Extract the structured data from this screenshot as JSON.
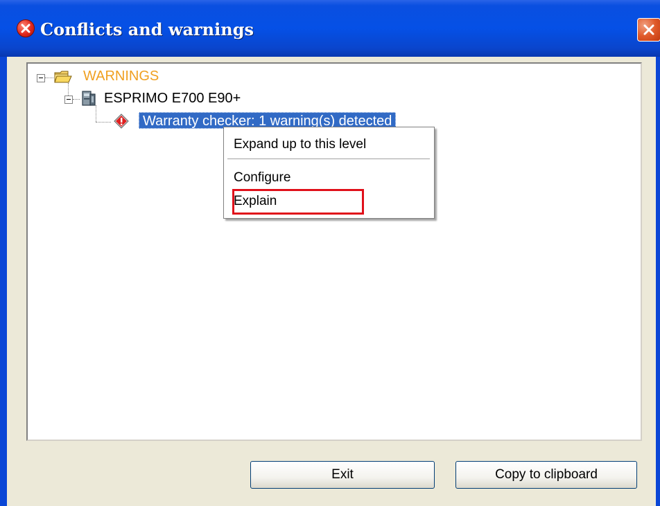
{
  "window": {
    "title": "Conflicts and warnings"
  },
  "tree": {
    "root_label": "WARNINGS",
    "device_label": "ESPRIMO E700 E90+",
    "selected_item_label": "Warranty checker: 1 warning(s)  detected"
  },
  "context_menu": {
    "items": [
      {
        "label": "Expand up to this level"
      },
      {
        "label": "Configure"
      },
      {
        "label": "Explain"
      }
    ],
    "highlight_color": "#e0101a"
  },
  "buttons": {
    "exit_label": "Exit",
    "copy_label": "Copy to clipboard"
  },
  "icons": {
    "title": "error-icon",
    "close": "close-icon",
    "root": "folder-icon",
    "device": "computer-icon",
    "warning": "warning-diamond-icon"
  },
  "colors": {
    "title_bar": "#0550e6",
    "selection": "#316ac5",
    "warnings_text": "#f0a020",
    "dialog_background": "#ece9d8"
  }
}
